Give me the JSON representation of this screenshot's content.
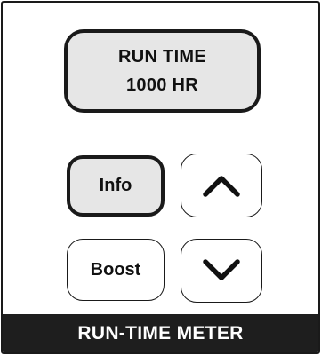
{
  "display": {
    "line1": "RUN TIME",
    "line2": "1000 HR"
  },
  "buttons": {
    "info_label": "Info",
    "boost_label": "Boost",
    "up_icon": "chevron-up-icon",
    "down_icon": "chevron-down-icon"
  },
  "footer": {
    "title": "RUN-TIME METER"
  },
  "colors": {
    "panel_border": "#1a1a1a",
    "display_bg": "#e6e6e6",
    "footer_bg": "#1e1e1e",
    "footer_text": "#ffffff"
  }
}
